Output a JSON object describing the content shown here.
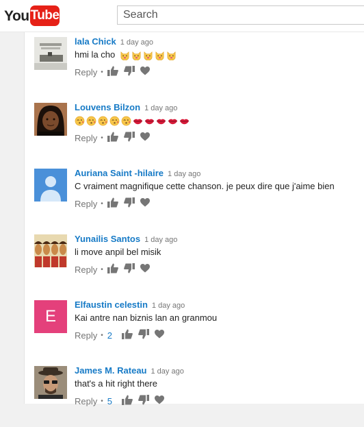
{
  "header": {
    "logo_you": "You",
    "logo_tube": "Tube",
    "search_placeholder": "Search"
  },
  "colors": {
    "brand_red": "#e62117",
    "link_blue": "#167ac6",
    "muted": "#767676"
  },
  "comments": [
    {
      "author": "lala Chick",
      "time": "1 day ago",
      "text": "hmi la cho",
      "emojis": [
        "kissing-cat-face",
        "kissing-cat-face",
        "kissing-cat-face",
        "kissing-cat-face",
        "kissing-cat-face"
      ],
      "reply": "Reply",
      "likes": ""
    },
    {
      "author": "Louvens Bilzon",
      "time": "1 day ago",
      "text": "",
      "emojis": [
        "face-blowing-kiss",
        "face-blowing-kiss",
        "face-blowing-kiss",
        "face-blowing-kiss",
        "face-blowing-kiss",
        "lips",
        "lips",
        "lips",
        "lips",
        "lips"
      ],
      "reply": "Reply",
      "likes": ""
    },
    {
      "author": "Auriana Saint -hilaire",
      "time": "1 day ago",
      "text": "C vraiment magnifique cette chanson.  je peux dire que j'aime bien",
      "emojis": [],
      "reply": "Reply",
      "likes": ""
    },
    {
      "author": "Yunailis Santos",
      "time": "1 day ago",
      "text": "li move anpil bel misik",
      "emojis": [],
      "reply": "Reply",
      "likes": ""
    },
    {
      "author": "Elfaustin celestin",
      "time": "1 day ago",
      "text": "Kai antre nan biznis lan an granmou",
      "emojis": [],
      "reply": "Reply",
      "likes": "2",
      "avatar_letter": "E"
    },
    {
      "author": "James M. Rateau",
      "time": "1 day ago",
      "text": "that's a hit right there",
      "emojis": [],
      "reply": "Reply",
      "likes": "5"
    }
  ]
}
